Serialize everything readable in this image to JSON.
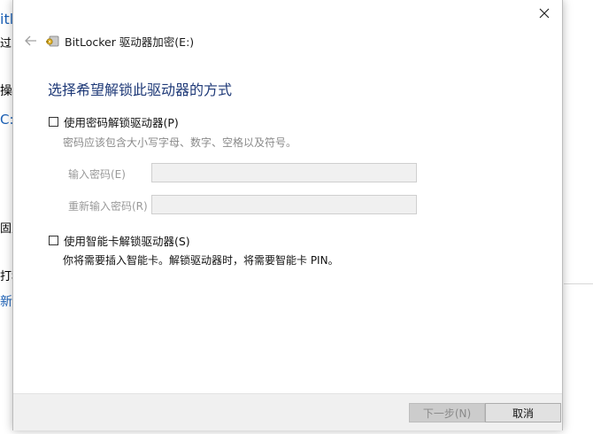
{
  "background_window": {
    "fragments": [
      {
        "text": "itl"
      },
      {
        "text": "过"
      },
      {
        "text": "操作"
      },
      {
        "text": "C:"
      },
      {
        "text": "固定"
      },
      {
        "text": "打移"
      },
      {
        "text": "新"
      }
    ]
  },
  "dialog": {
    "title": "BitLocker 驱动器加密(E:)",
    "heading": "选择希望解锁此驱动器的方式",
    "password_option": {
      "label": "使用密码解锁驱动器(P)",
      "hint": "密码应该包含大小写字母、数字、空格以及符号。",
      "enter_label": "输入密码(E)",
      "reenter_label": "重新输入密码(R)"
    },
    "smartcard_option": {
      "label": "使用智能卡解锁驱动器(S)",
      "hint": "你将需要插入智能卡。解锁驱动器时，将需要智能卡 PIN。"
    },
    "buttons": {
      "next": "下一步(N)",
      "cancel": "取消"
    }
  },
  "icons": {
    "close": "close-icon",
    "back": "back-arrow-icon",
    "bitlocker": "bitlocker-key-icon"
  },
  "colors": {
    "heading": "#1f3a78",
    "hint_gray": "#8a8a8a",
    "footer_bg": "#f0f0f0"
  }
}
